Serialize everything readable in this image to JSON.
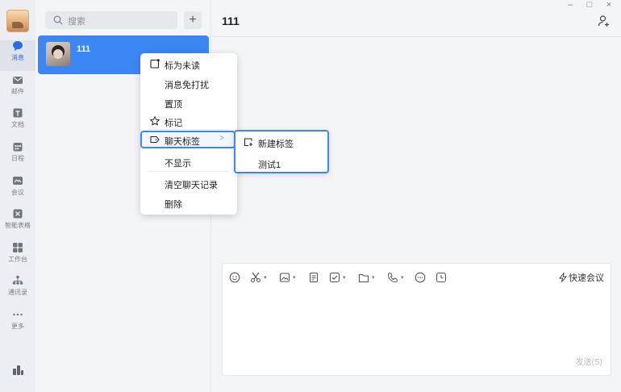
{
  "rail": {
    "items": [
      {
        "label": "消息",
        "icon": "chat-bubble-icon"
      },
      {
        "label": "邮件",
        "icon": "mail-icon"
      },
      {
        "label": "文档",
        "icon": "document-icon"
      },
      {
        "label": "日程",
        "icon": "calendar-icon"
      },
      {
        "label": "会议",
        "icon": "meeting-icon"
      },
      {
        "label": "智能表格",
        "icon": "smart-table-icon"
      },
      {
        "label": "工作台",
        "icon": "workbench-icon"
      },
      {
        "label": "通讯录",
        "icon": "contacts-icon"
      },
      {
        "label": "更多",
        "icon": "more-icon"
      }
    ]
  },
  "list": {
    "search_placeholder": "搜索",
    "add_label": "+",
    "conversations": [
      {
        "name": "111"
      }
    ]
  },
  "main": {
    "title": "111",
    "window_controls": {
      "minimize": "–",
      "maximize": "□",
      "close": "×"
    },
    "quick_meeting": "快速会议",
    "send_label": "发送(S)"
  },
  "context_menu": {
    "items": [
      {
        "label": "标为未读",
        "icon": "unread-square-icon"
      },
      {
        "label": "消息免打扰",
        "icon": ""
      },
      {
        "label": "置顶",
        "icon": ""
      },
      {
        "label": "标记",
        "icon": "star-icon"
      },
      {
        "label": "聊天标签",
        "icon": "tag-icon",
        "arrow": ">"
      },
      {
        "label": "不显示",
        "icon": ""
      },
      {
        "label": "清空聊天记录",
        "icon": ""
      },
      {
        "label": "删除",
        "icon": ""
      }
    ],
    "submenu": [
      {
        "label": "新建标签",
        "icon": "new-tag-icon"
      },
      {
        "label": "测试1",
        "icon": ""
      }
    ]
  },
  "colors": {
    "accent": "#3d87f5",
    "background": "#f4f5f7"
  }
}
